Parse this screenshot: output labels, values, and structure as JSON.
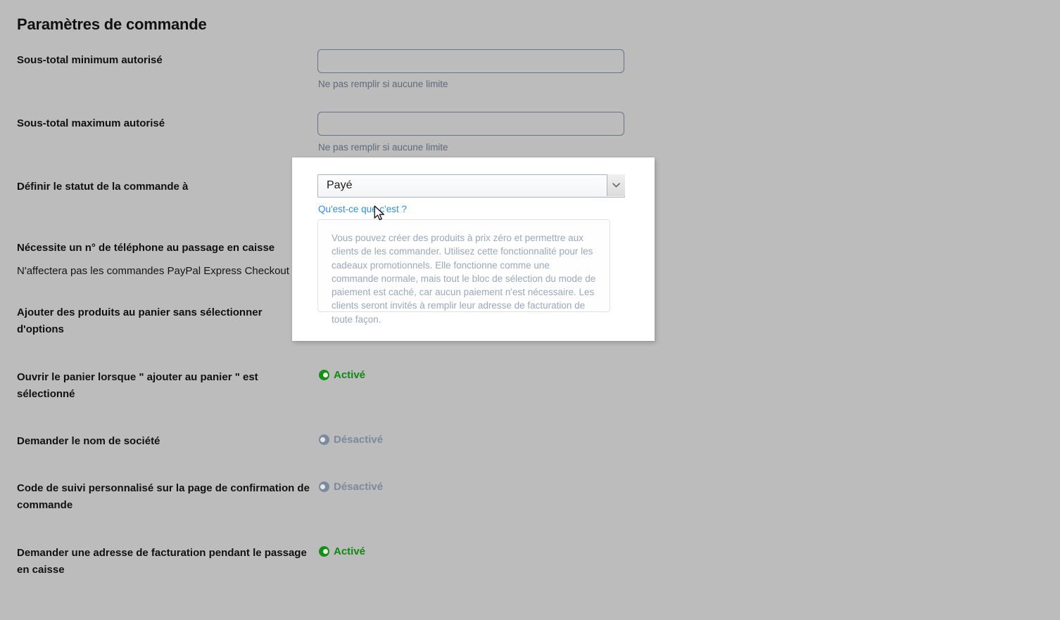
{
  "page": {
    "title": "Paramètres de commande",
    "background_color": "#bcbcbc"
  },
  "settings": [
    {
      "label": "Sous-total minimum autorisé",
      "control": "text-input",
      "value": "",
      "placeholder": "",
      "hint": "Ne pas remplir si aucune limite"
    },
    {
      "label": "Sous-total maximum autorisé",
      "control": "text-input",
      "value": "",
      "placeholder": "",
      "hint": "Ne pas remplir si aucune limite"
    },
    {
      "label": "Définir le statut de la commande à",
      "control": "select",
      "value": "Payé",
      "help_link": "Qu'est-ce que c'est ?"
    },
    {
      "label": "Nécessite un n° de téléphone au passage en caisse",
      "sublabel": "N'affectera pas les commandes PayPal Express Checkout",
      "control": "select",
      "value": ""
    },
    {
      "label": "Ajouter des produits au panier sans sélectionner d'options",
      "control": "select",
      "value": ""
    },
    {
      "label": "Ouvrir le panier lorsque \" ajouter au panier \" est sélectionné",
      "control": "toggle",
      "state": "on",
      "state_label": "Activé"
    },
    {
      "label": "Demander le nom de société",
      "control": "toggle",
      "state": "off",
      "state_label": "Désactivé"
    },
    {
      "label": "Code de suivi personnalisé sur la page de confirmation de commande",
      "control": "toggle",
      "state": "off",
      "state_label": "Désactivé"
    },
    {
      "label": "Demander une adresse de facturation pendant le passage en caisse",
      "control": "toggle",
      "state": "on",
      "state_label": "Activé"
    }
  ],
  "tooltip": {
    "visible": true,
    "text": "Vous pouvez créer des produits à prix zéro et permettre aux clients de les commander. Utilisez cette fonctionnalité pour les cadeaux promotionnels. Elle fonctionne comme une commande normale, mais tout le bloc de sélection du mode de paiement est caché, car aucun paiement n'est nécessaire. Les clients seront invités à remplir leur adresse de facturation de toute façon.",
    "text_color": "#9aa8bb",
    "border_color": "#dfe3e8"
  },
  "colors": {
    "accent_link": "#2f8fe0",
    "toggle_on": "#149014",
    "toggle_off": "#7c8a9c",
    "input_border": "#64748c",
    "hint_text": "#5c6b7a"
  }
}
